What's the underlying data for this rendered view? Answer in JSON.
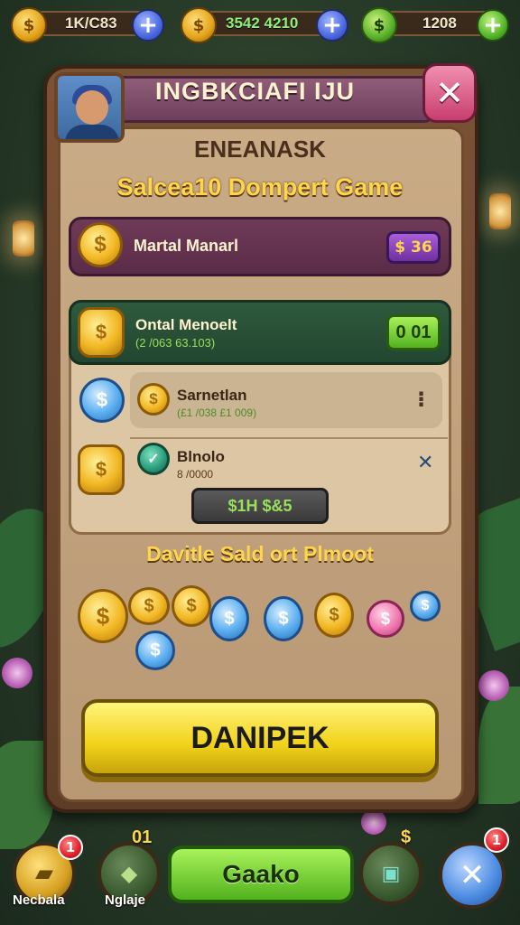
{
  "top_bar": {
    "currency_1": "1K/C83",
    "currency_2": "3542 4210",
    "currency_3": "1208",
    "plus": "+"
  },
  "header": {
    "title": "INGBKCIAFI IJU",
    "close": "✕"
  },
  "panel": {
    "subtitle": "ENEANASK",
    "heading": "Salcea10 Dompert Game",
    "row_purple": {
      "label": "Martal Manarl",
      "badge": "$ 36"
    },
    "row_green": {
      "label": "Ontal Menoelt",
      "sub": "(2 /063 63.103)",
      "button": "0 01"
    },
    "row_light": {
      "label": "Sarnetlan",
      "sub": "(£1 /038 £1 009)",
      "menu": "⁝"
    },
    "row_plain": {
      "label": "Blnolo",
      "sub": "8 /0000",
      "close": "✕"
    },
    "dark_button": "$1H $&5",
    "coins_heading": "Davitle Sald ort Plmoot",
    "main_button": "DANIPEK"
  },
  "bottom_bar": {
    "left_label": "Necbala",
    "left_badge": "1",
    "mid_label": "Nglaje",
    "mid_top": "01",
    "play_button": "Gaako",
    "right_badge": "1",
    "right_icon": "$"
  },
  "colors": {
    "gold": "#f2b824",
    "panel_brown": "#7a5236",
    "accent_yellow": "#ffd54a",
    "green_button": "#52b21e",
    "close_pink": "#c83e6e"
  }
}
